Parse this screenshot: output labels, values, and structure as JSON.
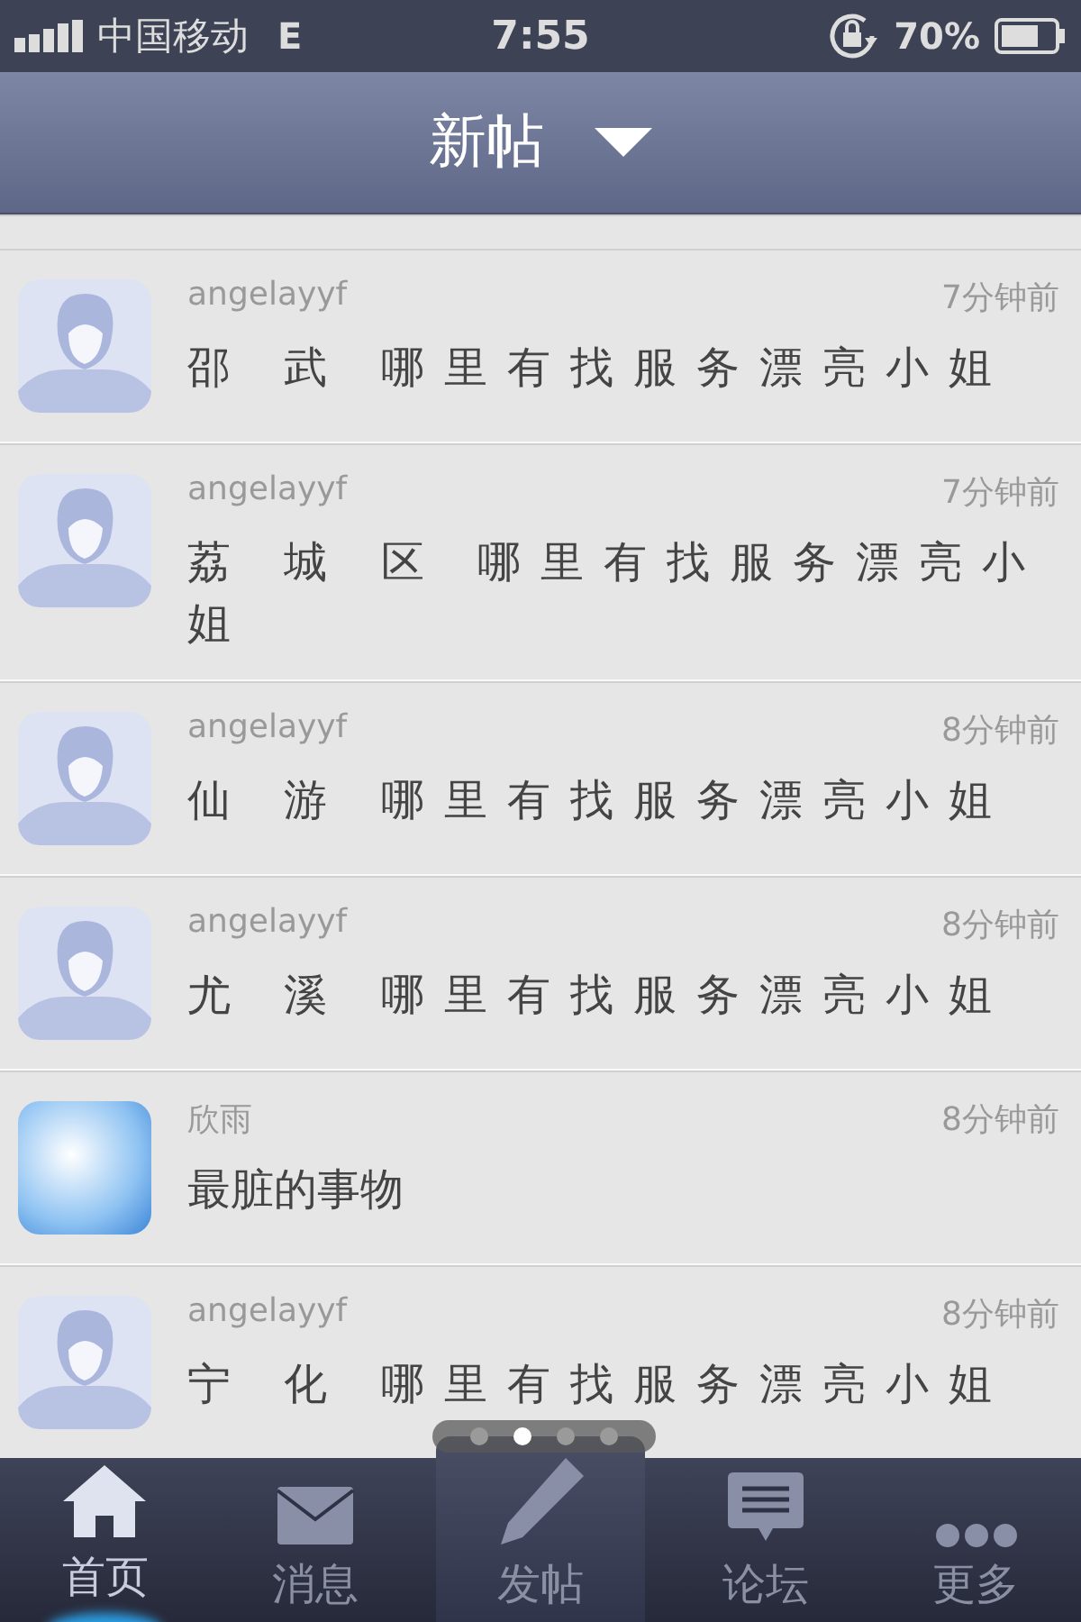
{
  "status_bar": {
    "carrier": "中国移动",
    "network": "E",
    "time": "7:55",
    "battery_text": "70%"
  },
  "nav_bar": {
    "title": "新帖"
  },
  "posts": [
    {
      "author": "angelayyf",
      "time": "7分钟前",
      "title": "邵 武 哪里有找服务漂亮小姐",
      "kind": "silhouette"
    },
    {
      "author": "angelayyf",
      "time": "7分钟前",
      "title": "荔 城 区 哪里有找服务漂亮小姐",
      "kind": "silhouette"
    },
    {
      "author": "angelayyf",
      "time": "8分钟前",
      "title": "仙 游 哪里有找服务漂亮小姐",
      "kind": "silhouette"
    },
    {
      "author": "angelayyf",
      "time": "8分钟前",
      "title": "尤 溪 哪里有找服务漂亮小姐",
      "kind": "silhouette"
    },
    {
      "author": "欣雨",
      "time": "8分钟前",
      "title": "最脏的事物",
      "kind": "photo"
    },
    {
      "author": "angelayyf",
      "time": "8分钟前",
      "title": "宁 化 哪里有找服务漂亮小姐",
      "kind": "silhouette"
    }
  ],
  "page_dots": [
    {
      "selected": false
    },
    {
      "selected": true
    },
    {
      "selected": false
    },
    {
      "selected": false
    }
  ],
  "tabs": [
    {
      "label": "首页",
      "selected": true,
      "kind": "normal"
    },
    {
      "label": "消息",
      "selected": false,
      "kind": "normal"
    },
    {
      "label": "发帖",
      "selected": false,
      "kind": "raised"
    },
    {
      "label": "论坛",
      "selected": false,
      "kind": "normal"
    },
    {
      "label": "更多",
      "selected": false,
      "kind": "normal"
    }
  ]
}
